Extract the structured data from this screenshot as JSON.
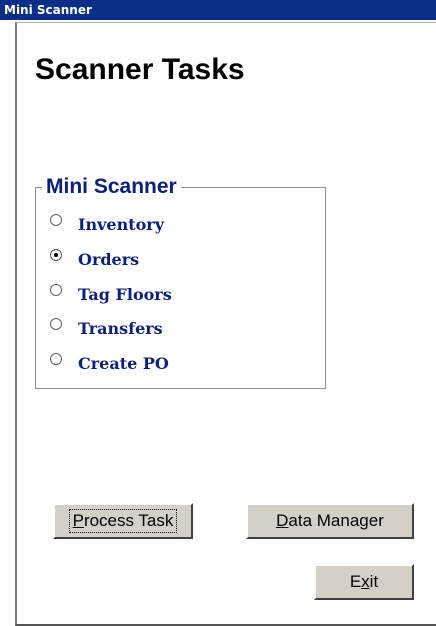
{
  "window": {
    "title": "Mini Scanner"
  },
  "main": {
    "heading": "Scanner Tasks"
  },
  "group": {
    "legend": "Mini Scanner",
    "options": [
      {
        "label": "Inventory",
        "checked": false
      },
      {
        "label": "Orders",
        "checked": true
      },
      {
        "label": "Tag Floors",
        "checked": false
      },
      {
        "label": "Transfers",
        "checked": false
      },
      {
        "label": "Create PO",
        "checked": false
      }
    ]
  },
  "buttons": {
    "process_task": {
      "pre": "",
      "accel": "P",
      "post": "rocess Task"
    },
    "data_manager": {
      "pre": "",
      "accel": "D",
      "post": "ata Manager"
    },
    "exit": {
      "pre": "E",
      "accel": "x",
      "post": "it"
    }
  },
  "colors": {
    "titlebar": "#0b2f86",
    "accent_text": "#0d1f7a",
    "button_face": "#d4d0c8"
  }
}
